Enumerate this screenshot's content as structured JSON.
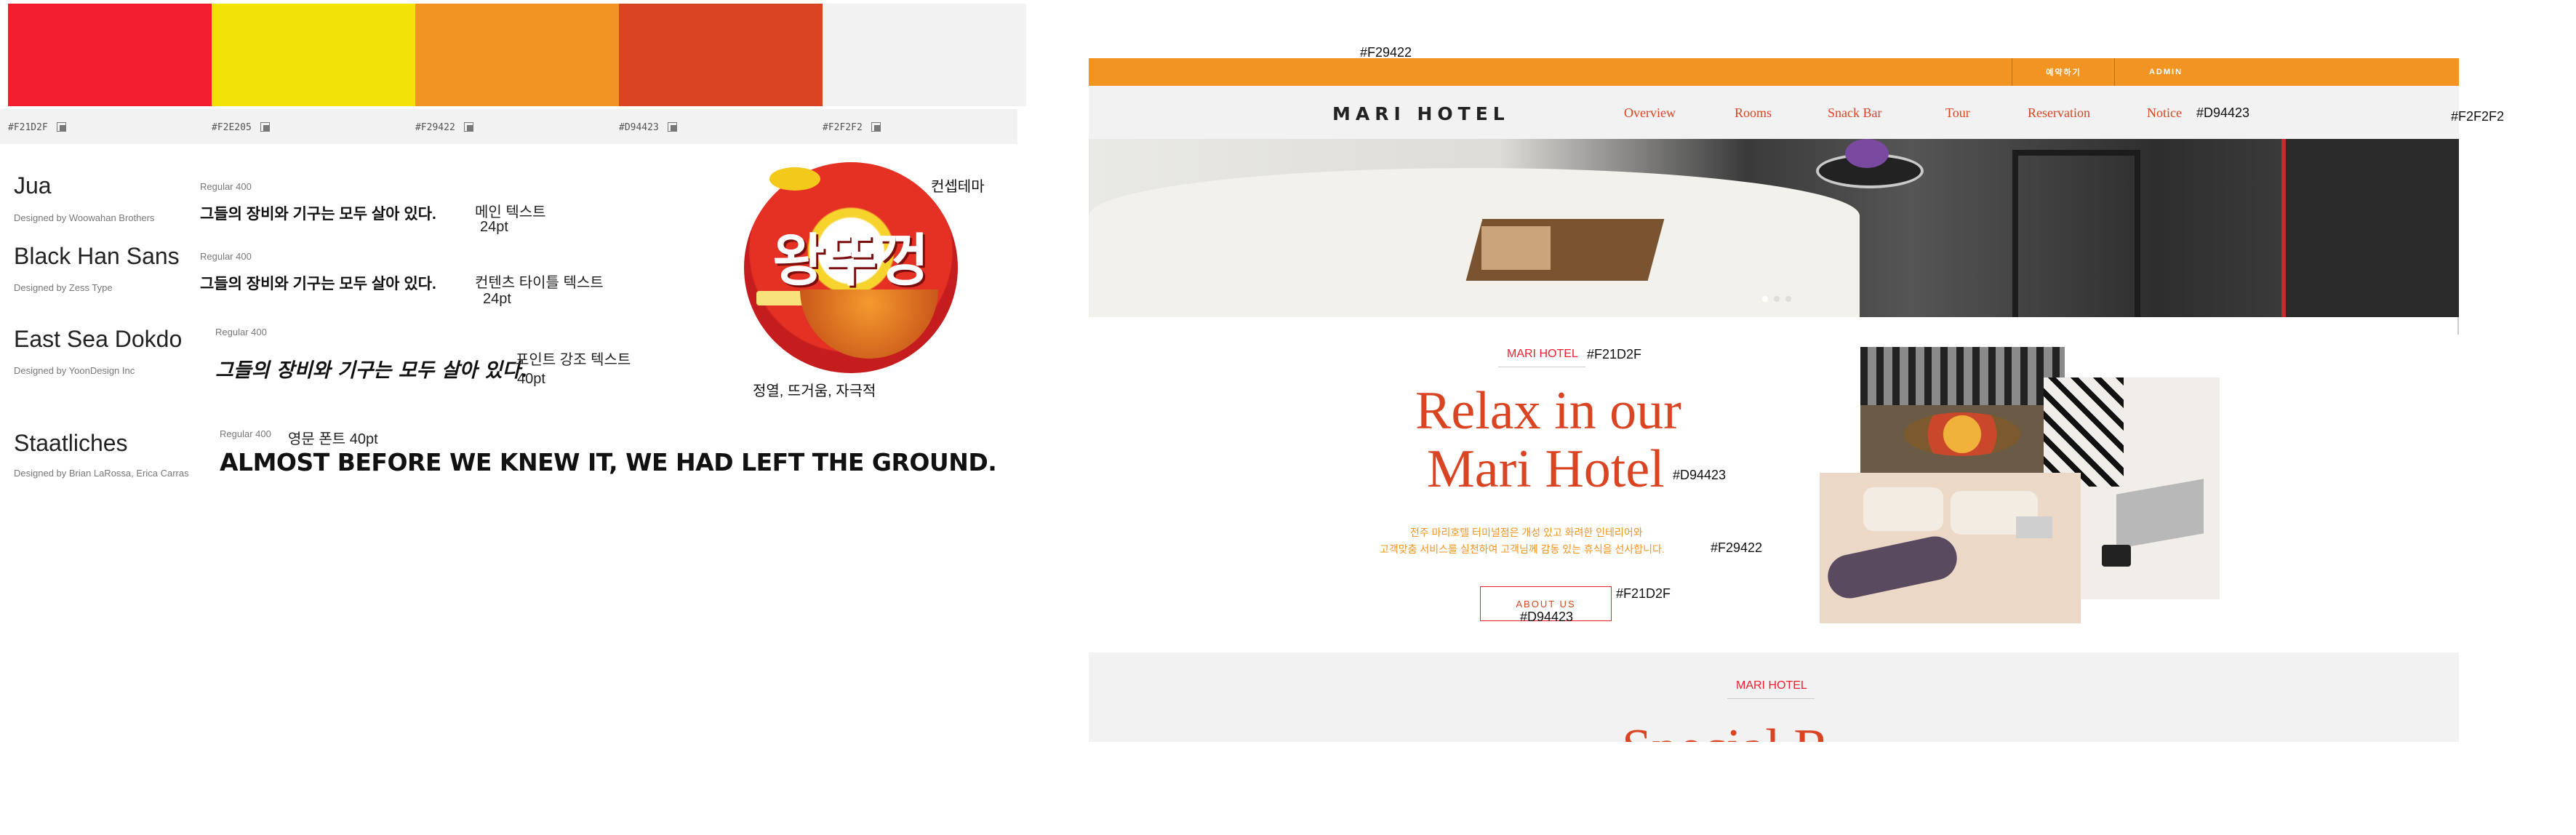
{
  "palette": {
    "swatches": [
      {
        "hex": "#F21D2F",
        "label": "#F21D2F"
      },
      {
        "hex": "#F2E205",
        "label": "#F2E205"
      },
      {
        "hex": "#F29422",
        "label": "#F29422"
      },
      {
        "hex": "#D94423",
        "label": "#D94423"
      },
      {
        "hex": "#F2F2F2",
        "label": "#F2F2F2"
      }
    ]
  },
  "fonts": [
    {
      "name": "Jua",
      "designer": "Designed by Woowahan Brothers",
      "weight": "Regular 400",
      "sample": "그들의 장비와 기구는 모두 살아 있다.",
      "note": "메인 텍스트",
      "size": "24pt"
    },
    {
      "name": "Black Han Sans",
      "designer": "Designed by Zess Type",
      "weight": "Regular 400",
      "sample": "그들의 장비와 기구는 모두 살아 있다.",
      "note": "컨텐츠 타이틀 텍스트",
      "size": "24pt"
    },
    {
      "name": "East Sea Dokdo",
      "designer": "Designed by YoonDesign Inc",
      "weight": "Regular 400",
      "sample": "그들의 장비와 기구는 모두 살아 있다.",
      "note": "포인트 강조 텍스트",
      "size": "40pt"
    },
    {
      "name": "Staatliches",
      "designer": "Designed by Brian LaRossa, Erica Carras",
      "weight": "Regular 400",
      "sample": "ALMOST BEFORE WE KNEW IT, WE HAD LEFT THE GROUND.",
      "note": "영문 폰트 40pt"
    }
  ],
  "concept": {
    "title": "컨셉테마",
    "image_text": "왕뚜껑",
    "caption": "정열, 뜨거움, 자극적"
  },
  "hotel": {
    "topbar_color_annotation": "#F29422",
    "topbar_buttons": [
      "예약하기",
      "ADMIN"
    ],
    "logo": "MARI HOTEL",
    "nav": [
      "Overview",
      "Rooms",
      "Snack Bar",
      "Tour",
      "Reservation",
      "Notice"
    ],
    "nav_color_annotation": "#D94423",
    "nav_bg_annotation": "#F2F2F2",
    "about": {
      "label": "MARI HOTEL",
      "label_annotation": "#F21D2F",
      "title_line1": "Relax in our",
      "title_line2": "Mari Hotel",
      "title_annotation": "#D94423",
      "body_line1": "전주 마리호텔 터미널점은 개성 있고 화려한 인테리어와",
      "body_line2": "고객맞춤 서비스를 실천하여 고객님께 감동 있는 휴식을 선사합니다.",
      "body_annotation": "#F29422",
      "button_label": "ABOUT US",
      "button_border_annotation": "#F21D2F",
      "button_text_annotation": "#D94423"
    },
    "special": {
      "label": "MARI HOTEL",
      "title": "Special R"
    }
  }
}
